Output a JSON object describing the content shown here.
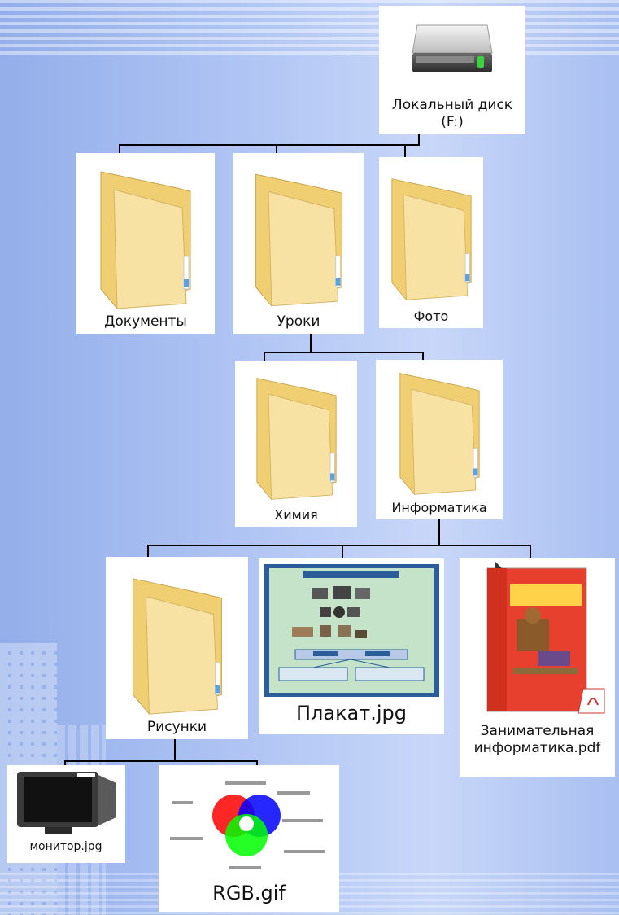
{
  "tree": {
    "root": {
      "label": "Локальный диск (F:)",
      "icon": "hard-drive-icon"
    },
    "level1": [
      {
        "label": "Документы",
        "icon": "folder-icon"
      },
      {
        "label": "Уроки",
        "icon": "folder-icon"
      },
      {
        "label": "Фото",
        "icon": "folder-icon"
      }
    ],
    "level2": [
      {
        "label": "Химия",
        "icon": "folder-icon"
      },
      {
        "label": "Информатика",
        "icon": "folder-icon"
      }
    ],
    "level3": [
      {
        "label": "Рисунки",
        "icon": "folder-icon"
      },
      {
        "label": "Плакат.jpg",
        "icon": "poster-image-icon"
      },
      {
        "label": "Занимательная информатика.pdf",
        "icon": "pdf-book-icon"
      }
    ],
    "level4": [
      {
        "label": "монитор.jpg",
        "icon": "monitor-image-icon"
      },
      {
        "label": "RGB.gif",
        "icon": "rgb-diagram-icon"
      }
    ]
  },
  "colors": {
    "background": "#b4c8f5",
    "folder": "#f3d98a",
    "line": "#000000"
  }
}
